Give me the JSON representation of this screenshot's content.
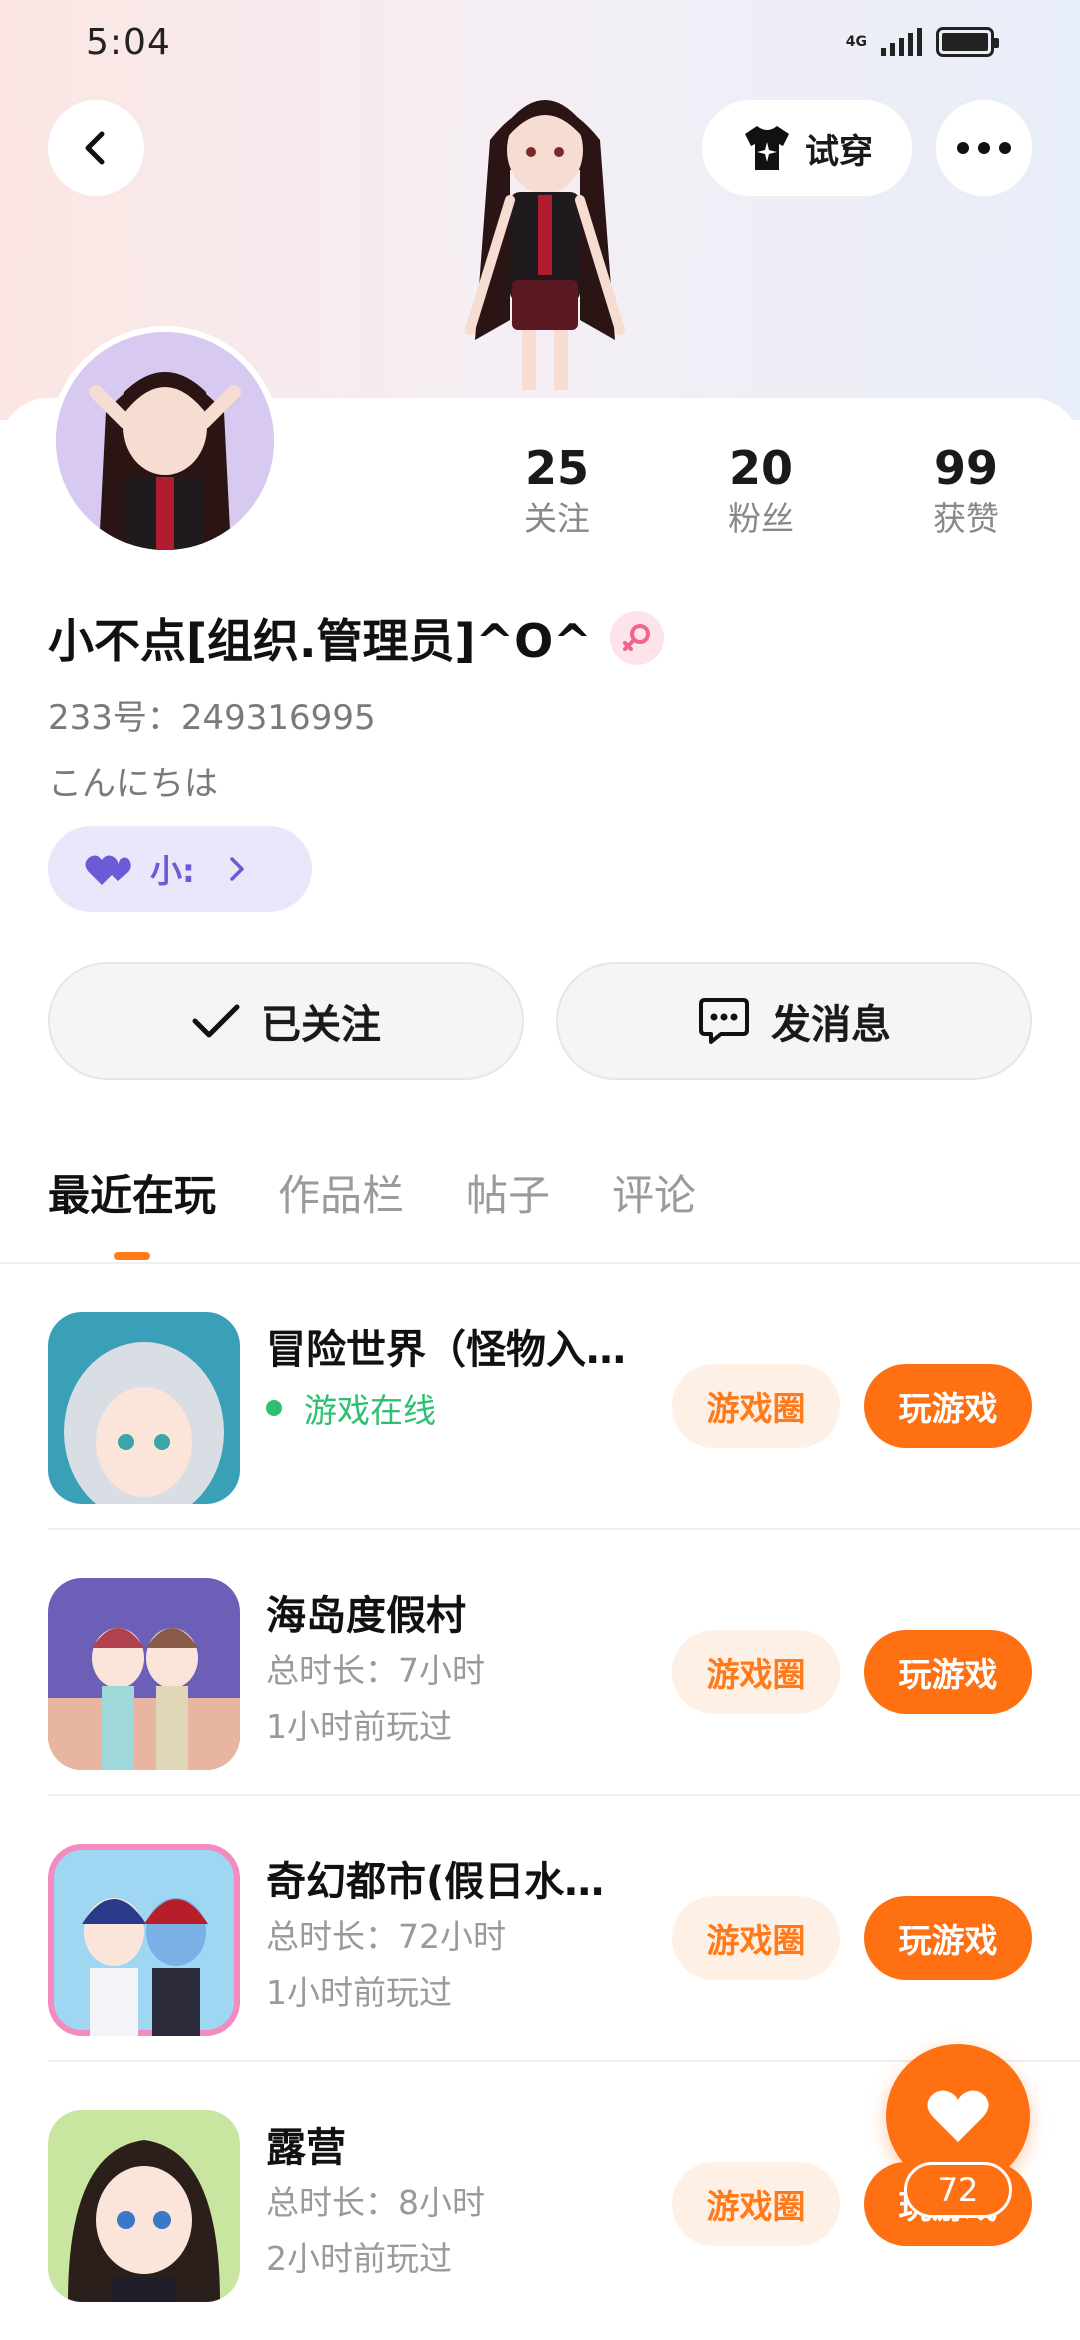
{
  "status_bar": {
    "time": "5:04",
    "network": "4G"
  },
  "header": {
    "tryon_label": "试穿"
  },
  "profile": {
    "stats": [
      {
        "value": "25",
        "label": "关注"
      },
      {
        "value": "20",
        "label": "粉丝"
      },
      {
        "value": "99",
        "label": "获赞"
      }
    ],
    "nickname": "小不点[组织.管理员]^O^",
    "user_id": "233号：249316995",
    "bio": "こんにちは",
    "relation_label": "小:"
  },
  "actions": {
    "follow_label": "已关注",
    "message_label": "发消息"
  },
  "tabs": [
    {
      "label": "最近在玩"
    },
    {
      "label": "作品栏"
    },
    {
      "label": "帖子"
    },
    {
      "label": "评论"
    }
  ],
  "games": [
    {
      "title": "冒险世界（怪物入…",
      "status": "游戏在线",
      "circle_label": "游戏圈",
      "play_label": "玩游戏"
    },
    {
      "title": "海岛度假村",
      "duration": "总时长：7小时",
      "last_played": "1小时前玩过",
      "circle_label": "游戏圈",
      "play_label": "玩游戏"
    },
    {
      "title": "奇幻都市(假日水…",
      "duration": "总时长：72小时",
      "last_played": "1小时前玩过",
      "circle_label": "游戏圈",
      "play_label": "玩游戏"
    },
    {
      "title": "露营",
      "duration": "总时长：8小时",
      "last_played": "2小时前玩过",
      "circle_label": "游戏圈",
      "play_label": "玩游戏"
    }
  ],
  "like": {
    "count": "72"
  },
  "colors": {
    "accent": "#ff7012",
    "online": "#2dbf72",
    "relation": "#6a5bd6"
  }
}
